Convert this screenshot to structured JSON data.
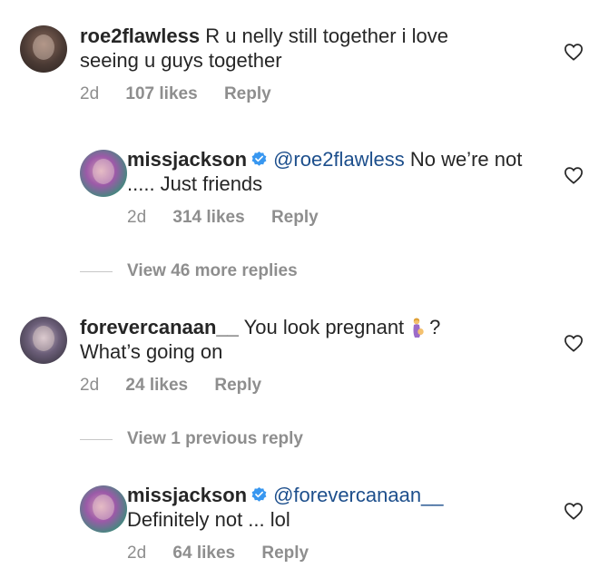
{
  "comments": [
    {
      "username": "roe2flawless",
      "text": "R u nelly still together i love seeing u guys together",
      "time": "2d",
      "likes": "107 likes",
      "reply_label": "Reply"
    },
    {
      "username": "missjackson",
      "mention": "@roe2flawless",
      "text": "No we’re not ..... Just friends",
      "time": "2d",
      "likes": "314 likes",
      "reply_label": "Reply"
    },
    {
      "username": "forevercanaan__",
      "text_before_emoji": "You look pregnant",
      "text_after_emoji": "?",
      "text_line2": "What’s going on",
      "emoji_icon": "pregnant-woman-emoji",
      "time": "2d",
      "likes": "24 likes",
      "reply_label": "Reply"
    },
    {
      "username": "missjackson",
      "mention": "@forevercanaan__",
      "text": "Definitely not ... lol",
      "time": "2d",
      "likes": "64 likes",
      "reply_label": "Reply"
    }
  ],
  "view_more_replies": "View 46 more replies",
  "view_previous_reply": "View 1 previous reply",
  "colors": {
    "text": "#262626",
    "meta": "#8e8e8e",
    "mention": "#1d4f8c",
    "verified": "#3897f0"
  }
}
